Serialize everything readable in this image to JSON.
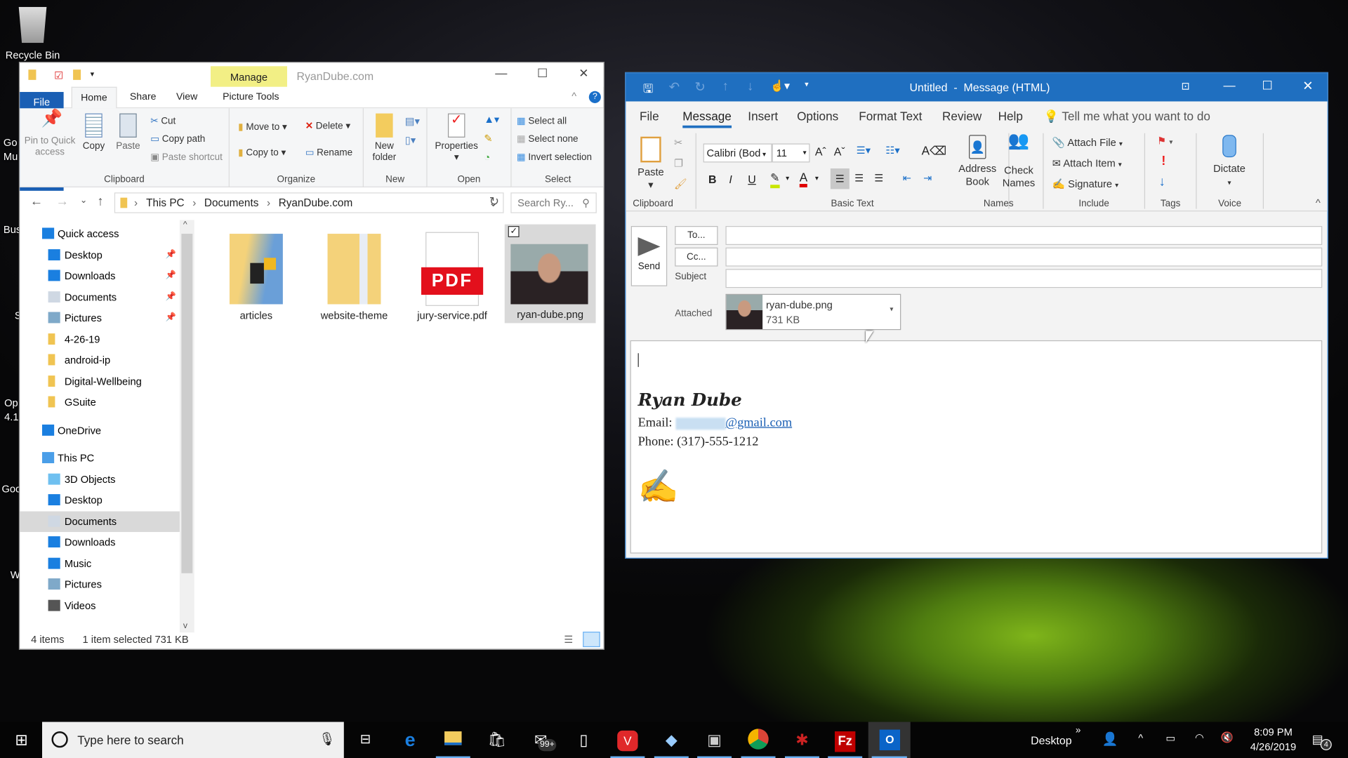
{
  "desktop": {
    "icons": [
      {
        "label": "Recycle Bin"
      },
      {
        "label": "Go Mu"
      },
      {
        "label": "Bus"
      },
      {
        "label": "S"
      },
      {
        "label": "Op 4.1"
      },
      {
        "label": "Goo"
      },
      {
        "label": "W"
      }
    ]
  },
  "explorer": {
    "title": "RyanDube.com",
    "contextual_tab": "Manage",
    "tabs": [
      "File",
      "Home",
      "Share",
      "View",
      "Picture Tools"
    ],
    "ribbon": {
      "clipboard": {
        "label": "Clipboard",
        "pin": "Pin to Quick access",
        "copy": "Copy",
        "paste": "Paste",
        "cut": "Cut",
        "copy_path": "Copy path",
        "paste_shortcut": "Paste shortcut"
      },
      "organize": {
        "label": "Organize",
        "move_to": "Move to",
        "delete": "Delete",
        "copy_to": "Copy to",
        "rename": "Rename"
      },
      "new": {
        "label": "New",
        "new_folder": "New folder"
      },
      "open": {
        "label": "Open",
        "properties": "Properties"
      },
      "select": {
        "label": "Select",
        "select_all": "Select all",
        "select_none": "Select none",
        "invert": "Invert selection"
      }
    },
    "breadcrumb": [
      "This PC",
      "Documents",
      "RyanDube.com"
    ],
    "search_placeholder": "Search Ry...",
    "nav": [
      {
        "label": "Quick access",
        "top": true,
        "icon": "star-icon"
      },
      {
        "label": "Desktop",
        "pinned": true,
        "icon": "desktop-icon"
      },
      {
        "label": "Downloads",
        "pinned": true,
        "icon": "download-icon"
      },
      {
        "label": "Documents",
        "pinned": true,
        "icon": "document-icon"
      },
      {
        "label": "Pictures",
        "pinned": true,
        "icon": "pictures-icon"
      },
      {
        "label": "4-26-19",
        "icon": "folder-icon"
      },
      {
        "label": "android-ip",
        "icon": "folder-icon"
      },
      {
        "label": "Digital-Wellbeing",
        "icon": "folder-icon"
      },
      {
        "label": "GSuite",
        "icon": "folder-icon"
      },
      {
        "label": "OneDrive",
        "top": true,
        "icon": "cloud-icon"
      },
      {
        "label": "This PC",
        "top": true,
        "icon": "computer-icon"
      },
      {
        "label": "3D Objects",
        "icon": "cube-icon"
      },
      {
        "label": "Desktop",
        "icon": "desktop-icon"
      },
      {
        "label": "Documents",
        "icon": "document-icon",
        "selected": true
      },
      {
        "label": "Downloads",
        "icon": "download-icon"
      },
      {
        "label": "Music",
        "icon": "music-icon"
      },
      {
        "label": "Pictures",
        "icon": "pictures-icon"
      },
      {
        "label": "Videos",
        "icon": "video-icon"
      }
    ],
    "files": [
      {
        "name": "articles",
        "type": "folder"
      },
      {
        "name": "website-theme",
        "type": "folder"
      },
      {
        "name": "jury-service.pdf",
        "type": "pdf",
        "badge": "PDF"
      },
      {
        "name": "ryan-dube.png",
        "type": "image",
        "selected": true
      }
    ],
    "status": {
      "count": "4 items",
      "selection": "1 item selected  731 KB"
    }
  },
  "outlook": {
    "title": "Untitled  -  Message (HTML)",
    "tabs": [
      "File",
      "Message",
      "Insert",
      "Options",
      "Format Text",
      "Review",
      "Help"
    ],
    "active_tab": "Message",
    "tell_me": "Tell me what you want to do",
    "ribbon": {
      "clipboard": "Clipboard",
      "paste": "Paste",
      "basic_text": "Basic Text",
      "font": "Calibri (Bod",
      "size": "11",
      "bold": "B",
      "italic": "I",
      "underline": "U",
      "names": "Names",
      "address_book": "Address Book",
      "check_names": "Check Names",
      "include": "Include",
      "attach_file": "Attach File",
      "attach_item": "Attach Item",
      "signature": "Signature",
      "tags": "Tags",
      "voice": "Voice",
      "dictate": "Dictate"
    },
    "send": "Send",
    "to": "To...",
    "cc": "Cc...",
    "subject": "Subject",
    "attached_label": "Attached",
    "attachment": {
      "name": "ryan-dube.png",
      "size": "731 KB"
    },
    "signature": {
      "name": "Ryan Dube",
      "email_label": "Email:",
      "email_domain": "@gmail.com",
      "phone": "Phone: (317)-555-1212"
    },
    "colors": {
      "accent": "#1f6fc0",
      "highlight": "#c8e600",
      "font_color": "#e00000"
    }
  },
  "taskbar": {
    "search_placeholder": "Type here to search",
    "mail_badge": "99+",
    "desktop_label": "Desktop",
    "time": "8:09 PM",
    "date": "4/26/2019",
    "notifications": "4"
  }
}
